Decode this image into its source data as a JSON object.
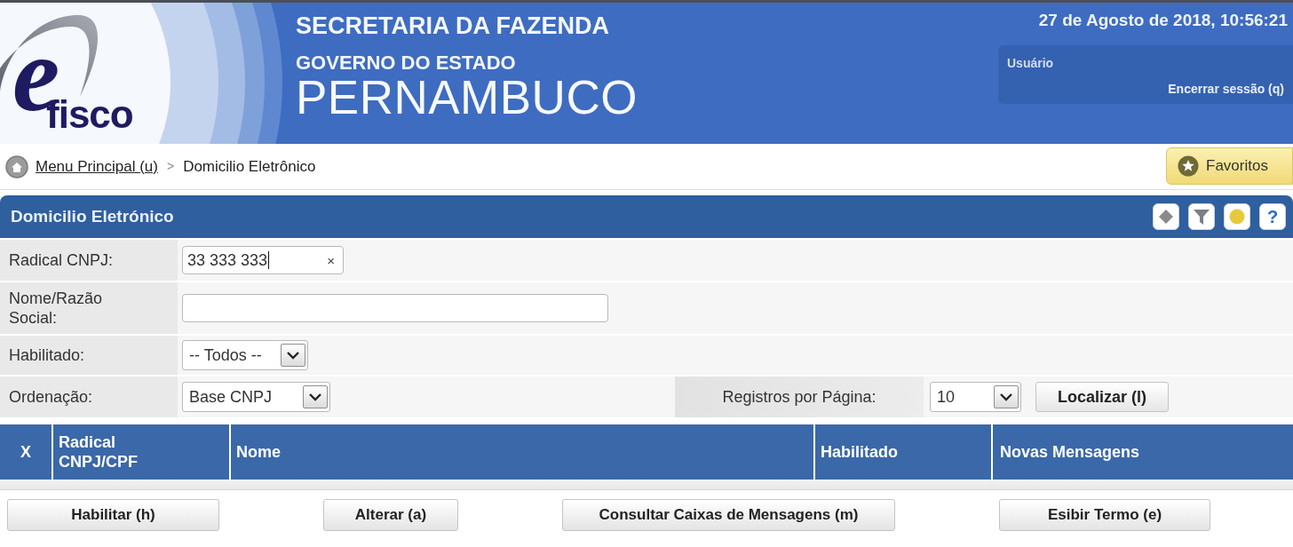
{
  "header": {
    "logo": {
      "letter": "e",
      "word": "fisco"
    },
    "titles": [
      "SECRETARIA DA FAZENDA",
      "GOVERNO DO ESTADO",
      "PERNAMBUCO"
    ],
    "datetime": "27 de Agosto de 2018, 10:56:21",
    "user": {
      "label": "Usuário",
      "logout": "Encerrar sessão (q)"
    }
  },
  "breadcrumb": {
    "items": [
      {
        "label": "Menu Principal (u)",
        "kind": "link"
      },
      {
        "label": "Domicilio Eletrônico",
        "kind": "current"
      }
    ],
    "separator": ">",
    "favorites": "Favoritos"
  },
  "panel": {
    "title": "Domicilio Eletrónico",
    "tools": [
      {
        "kind": "diamond"
      },
      {
        "kind": "filter"
      },
      {
        "kind": "circle"
      },
      {
        "kind": "help",
        "label": "?"
      }
    ]
  },
  "form": {
    "rows": [
      {
        "label": "Radical CNPJ:",
        "field": {
          "kind": "text",
          "value": "33 333 333",
          "clear": "×",
          "focused": true
        }
      },
      {
        "label": "Nome/Razão Social:",
        "field": {
          "kind": "text",
          "focused": false
        }
      },
      {
        "label": "Habilitado:",
        "field": {
          "kind": "select",
          "value": "-- Todos --"
        }
      },
      {
        "label": "Ordenação:",
        "field": {
          "kind": "select",
          "value": "Base CNPJ"
        },
        "extra": {
          "label": "Registros por Página:",
          "field": {
            "kind": "select",
            "value": "10"
          },
          "button": "Localizar (l)"
        }
      }
    ]
  },
  "table": {
    "columns": [
      "X",
      "Radical CNPJ/CPF",
      "Nome",
      "Habilitado",
      "Novas Mensagens"
    ]
  },
  "actions": [
    "Habilitar (h)",
    "Alterar (a)",
    "Consultar Caixas de Mensagens (m)",
    "Esibir Termo (e)"
  ]
}
